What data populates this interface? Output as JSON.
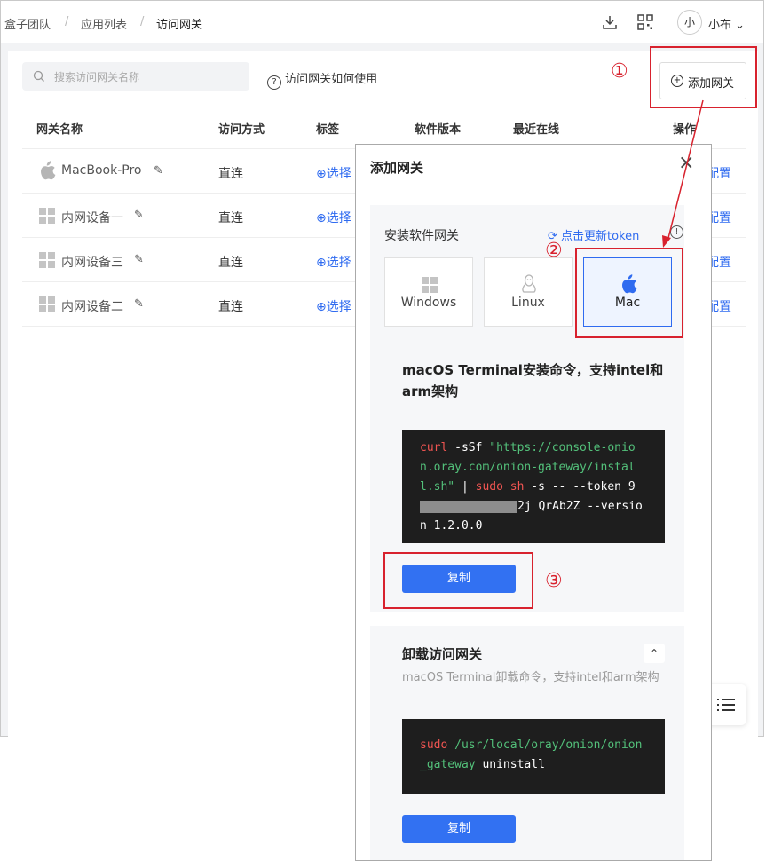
{
  "breadcrumb": {
    "items": [
      "盒子团队",
      "应用列表",
      "访问网关"
    ],
    "sep": "/"
  },
  "user": {
    "avatar": "小",
    "name": "小布"
  },
  "toolbar": {
    "search_placeholder": "搜索访问网关名称",
    "help": "访问网关如何使用",
    "add_button": "添加网关"
  },
  "table": {
    "headers": [
      "网关名称",
      "访问方式",
      "标签",
      "软件版本",
      "最近在线",
      "操作"
    ],
    "rows": [
      {
        "name": "MacBook-Pro",
        "os_icon": "apple-icon",
        "access": "直连",
        "tag": "选择",
        "action": "配置"
      },
      {
        "name": "内网设备一",
        "os_icon": "windows-icon",
        "access": "直连",
        "tag": "选择",
        "action": "配置"
      },
      {
        "name": "内网设备三",
        "os_icon": "windows-icon",
        "access": "直连",
        "tag": "选择",
        "action": "配置"
      },
      {
        "name": "内网设备二",
        "os_icon": "windows-icon",
        "access": "直连",
        "tag": "选择",
        "action": "配置"
      }
    ]
  },
  "annotations": {
    "step1": "①",
    "step2": "②",
    "step3": "③",
    "color": "#d8222e"
  },
  "panel": {
    "title": "添加网关",
    "install_title": "安装软件网关",
    "refresh": "点击更新token",
    "os_options": [
      {
        "label": "Windows",
        "icon": "windows-icon",
        "selected": false
      },
      {
        "label": "Linux",
        "icon": "linux-icon",
        "selected": false
      },
      {
        "label": "Mac",
        "icon": "apple-icon",
        "selected": true
      }
    ],
    "install": {
      "heading": "macOS Terminal安装命令，支持intel和arm架构",
      "cmd_curl": "curl",
      "cmd_flags": " -sSf ",
      "cmd_url": "\"https://console-onion.oray.com/onion-gateway/install.sh\"",
      "cmd_pipe": " | ",
      "cmd_sudo": "sudo",
      "cmd_sh": " sh",
      "cmd_rest1": " -s -- --token 9",
      "cmd_rest2": "2j QrAb2Z --version 1.2.0.0",
      "copy": "复制"
    },
    "uninstall": {
      "heading": "卸载访问网关",
      "desc": "macOS Terminal卸载命令，支持intel和arm架构",
      "cmd_sudo": "sudo",
      "cmd_path": " /usr/local/oray/onion/onion_gateway",
      "cmd_rest": " uninstall",
      "copy": "复制"
    }
  },
  "colors": {
    "accent": "#3271f2",
    "link": "#2f6bf0",
    "annotation": "#d8222e",
    "code_bg": "#1e1e1e"
  }
}
